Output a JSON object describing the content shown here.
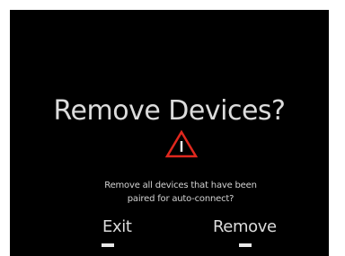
{
  "dialog": {
    "title": "Remove Devices?",
    "icon": "warning-icon",
    "message_line1": "Remove all devices that have been",
    "message_line2": "paired for auto-connect?",
    "exit_label": "Exit",
    "remove_label": "Remove"
  },
  "colors": {
    "background": "#000000",
    "text": "#dcdcdc",
    "warning": "#e0281e"
  }
}
